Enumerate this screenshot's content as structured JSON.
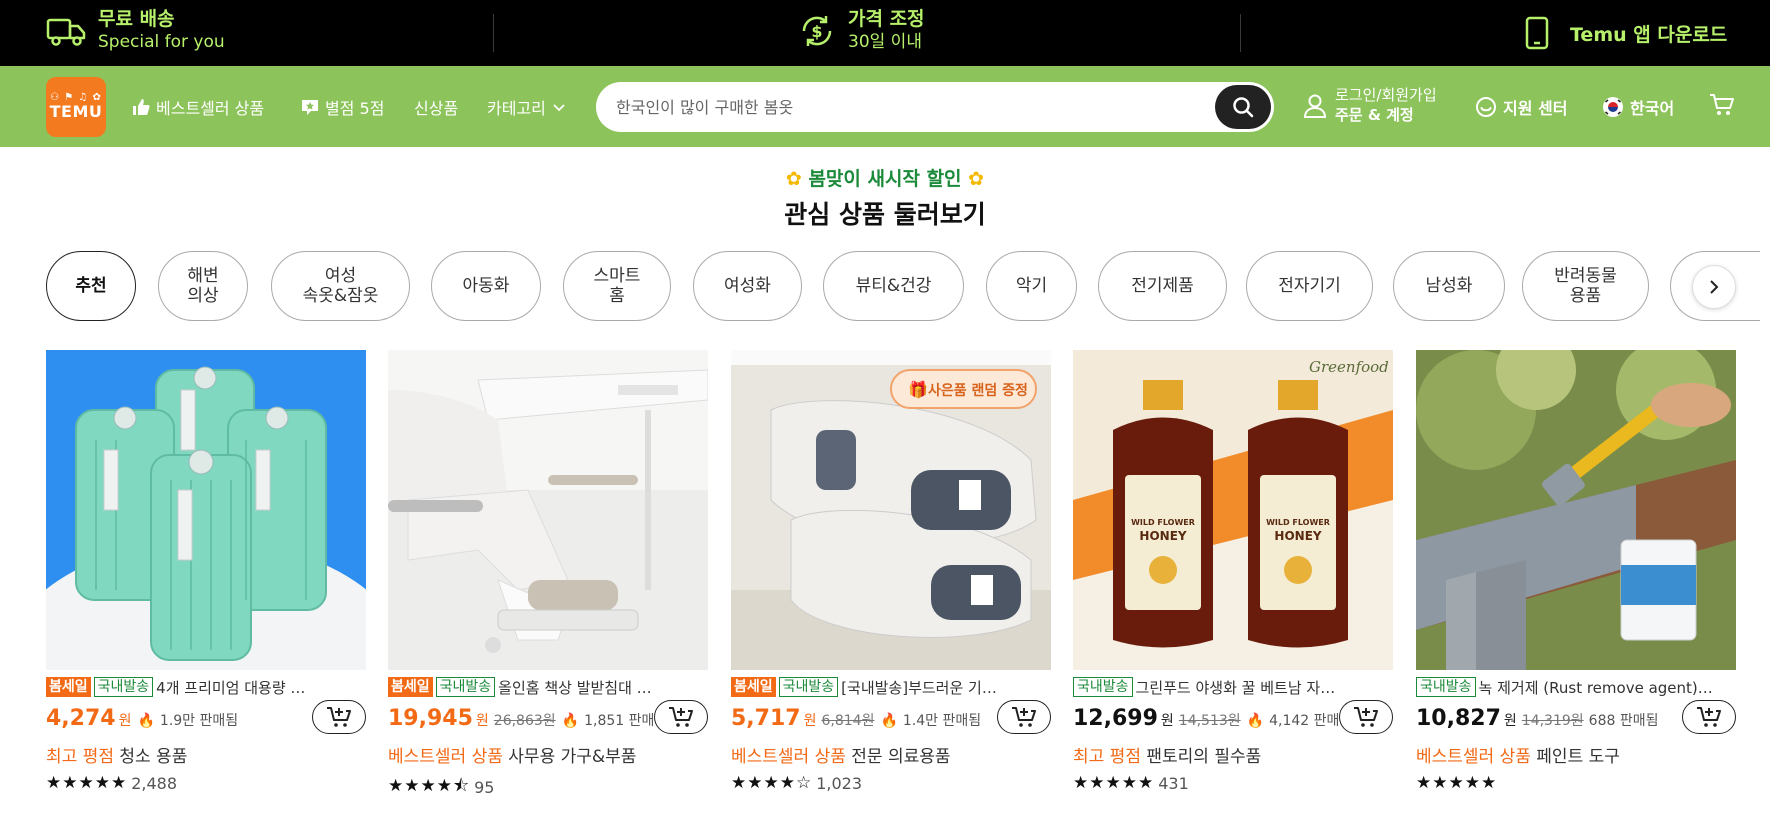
{
  "topbar": {
    "shipping_title": "무료 배송",
    "shipping_sub": "Special for you",
    "price_title": "가격 조정",
    "price_sub": "30일 이내",
    "app_download": "Temu 앱 다운로드"
  },
  "nav": {
    "logo_text": "TEMU",
    "bestseller": "베스트셀러 상품",
    "five_star": "별점 5점",
    "new_items": "신상품",
    "categories": "카테고리",
    "search_placeholder": "한국인이 많이 구매한 봄옷",
    "login": "로그인/회원가입",
    "orders": "주문 & 계정",
    "support": "지원 센터",
    "language": "한국어"
  },
  "promo": {
    "tag": "봄맞이 새시작 할인",
    "title": "관심 상품 둘러보기"
  },
  "categories": [
    "추천",
    "해변\n의상",
    "여성\n속옷&잠옷",
    "아동화",
    "스마트\n홈",
    "여성화",
    "뷰티&건강",
    "악기",
    "전기제품",
    "전자기기",
    "남성화",
    "반려동물\n용품"
  ],
  "products": [
    {
      "sale_badge": "봄세일",
      "domestic_badge": "국내발송",
      "title": "4개 프리미엄 대용량 …",
      "price": "4,274",
      "currency": "원",
      "old_price": "",
      "sold": "1.9만 판매됨",
      "tag_label": "최고 평점",
      "tag_category": "청소 용품",
      "stars": "★★★★★",
      "rating": 4.9,
      "reviews": "2,488"
    },
    {
      "sale_badge": "봄세일",
      "domestic_badge": "국내발송",
      "title": "올인홈 책상 발받침대 …",
      "price": "19,945",
      "currency": "원",
      "old_price": "26,863원",
      "sold": "1,851 판매됨",
      "tag_label": "베스트셀러 상품",
      "tag_category": "사무용 가구&부품",
      "stars": "★★★★⯪",
      "rating": 4.5,
      "reviews": "95"
    },
    {
      "sale_badge": "봄세일",
      "domestic_badge": "국내발송",
      "title": "[국내발송]부드러운 기…",
      "price": "5,717",
      "currency": "원",
      "old_price": "6,814원",
      "sold": "1.4만 판매됨",
      "tag_label": "베스트셀러 상품",
      "tag_category": "전문 의료용품",
      "stars": "★★★★☆",
      "rating": 4.2,
      "reviews": "1,023",
      "gift_badge": "사은품 랜덤 증정"
    },
    {
      "sale_badge": "",
      "domestic_badge": "국내발송",
      "title": "그린푸드 야생화 꿀 베트남 자…",
      "price": "12,699",
      "currency": "원",
      "old_price": "14,513원",
      "sold": "4,142 판매됨",
      "tag_label": "최고 평점",
      "tag_category": "팬토리의 필수품",
      "stars": "★★★★★",
      "rating": 4.9,
      "reviews": "431",
      "brand": "Greenfood",
      "honey_label": "WILD FLOWER HONEY"
    },
    {
      "sale_badge": "",
      "domestic_badge": "국내발송",
      "title": "녹 제거제 (Rust remove agent)…",
      "price": "10,827",
      "currency": "원",
      "old_price": "14,319원",
      "sold": "688 판매됨",
      "tag_label": "베스트셀러 상품",
      "tag_category": "페인트 도구",
      "stars": "★★★★★",
      "rating": 5.0,
      "reviews": ""
    }
  ],
  "colors": {
    "accent_green": "#8cc35a",
    "promo_green": "#1b8a3a",
    "brand_orange": "#f47a1f",
    "sale_orange": "#f36a16",
    "banner_text": "#b7f06a"
  }
}
